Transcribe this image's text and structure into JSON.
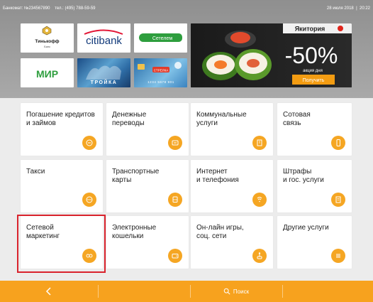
{
  "status_bar": {
    "terminal": "Банкомат: №234567890",
    "phone": "тел.: (495) 788-59-59",
    "date": "28 июля 2018",
    "time": "20:22"
  },
  "banners": {
    "tinkoff": {
      "name": "Тинькофф",
      "sub": "Банк"
    },
    "citi": {
      "name": "citibank"
    },
    "green": {
      "name": "Сетелем"
    },
    "mir": {
      "name": "МИР"
    },
    "troika": {
      "name": "ТРОЙКА"
    },
    "strelka": {
      "name": "СТРЕЛКА",
      "card_number": "1234 5678 901"
    },
    "ad": {
      "brand": "Якитория",
      "discount": "-50%",
      "caption": "акция дня",
      "button": "Получить"
    }
  },
  "services": [
    {
      "label": "Погашение кредитов\nи займов",
      "icon": "coins-icon"
    },
    {
      "label": "Денежные\nпереводы",
      "icon": "transfer-icon"
    },
    {
      "label": "Коммунальные\nуслуги",
      "icon": "house-icon"
    },
    {
      "label": "Сотовая\nсвязь",
      "icon": "phone-icon"
    },
    {
      "label": "Такси",
      "icon": "taxi-icon"
    },
    {
      "label": "Транспортные\nкарты",
      "icon": "bus-icon"
    },
    {
      "label": "Интернет\nи телефония",
      "icon": "wifi-icon"
    },
    {
      "label": "Штрафы\nи гос. услуги",
      "icon": "document-icon"
    },
    {
      "label": "Сетевой\nмаркетинг",
      "icon": "network-icon"
    },
    {
      "label": "Электронные\nкошельки",
      "icon": "wallet-icon"
    },
    {
      "label": "Он-лайн игры,\nсоц. сети",
      "icon": "joystick-icon"
    },
    {
      "label": "Другие услуги",
      "icon": "list-icon"
    }
  ],
  "bottom_bar": {
    "back_label": "<",
    "search_label": "Поиск"
  },
  "colors": {
    "accent": "#f7a21e",
    "icon_bg": "#f5a623",
    "highlight": "#d9232d"
  }
}
